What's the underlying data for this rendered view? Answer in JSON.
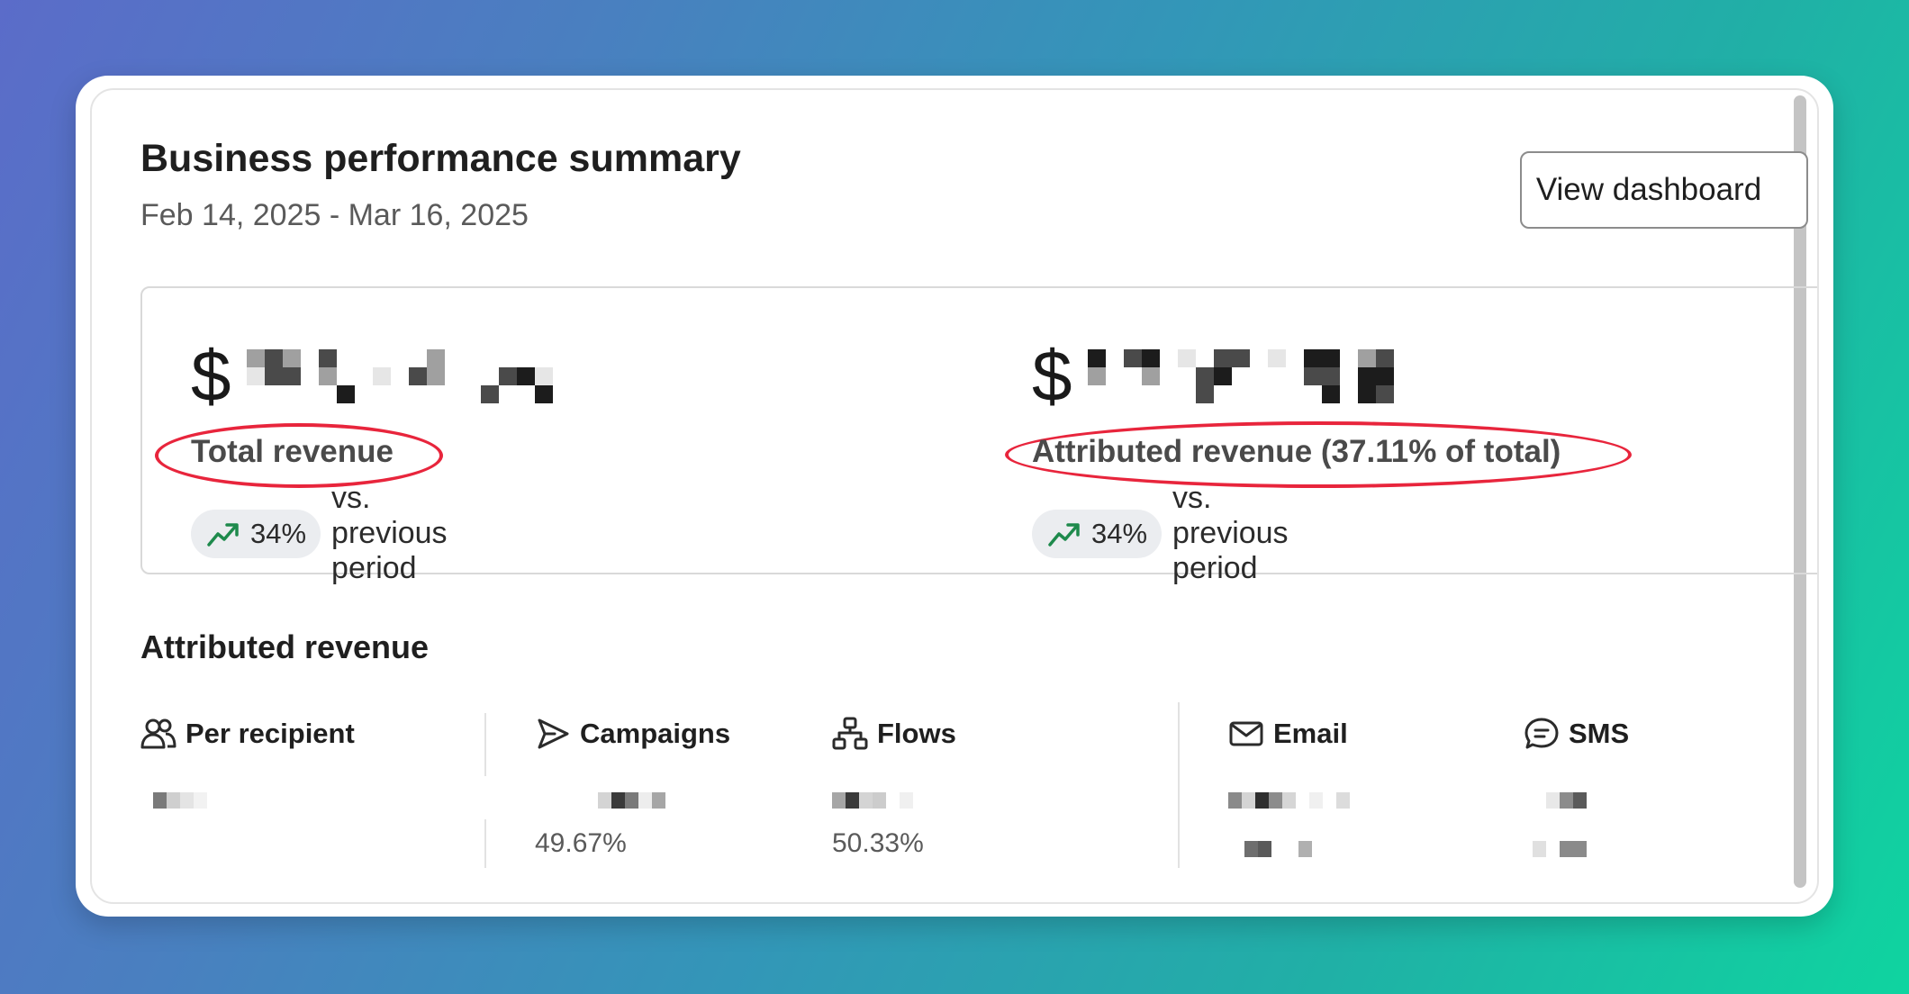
{
  "card": {
    "title": "Business performance summary",
    "date_range": "Feb 14, 2025 - Mar 16, 2025",
    "view_dashboard_label": "View dashboard"
  },
  "metrics": {
    "total": {
      "currency": "$",
      "label": "Total revenue",
      "delta": "34%",
      "delta_suffix": "vs. previous period"
    },
    "attributed": {
      "currency": "$",
      "label": "Attributed revenue (37.11% of total)",
      "delta": "34%",
      "delta_suffix": "vs. previous period"
    }
  },
  "attributed_section": {
    "title": "Attributed revenue",
    "per_recipient_label": "Per recipient",
    "campaigns_label": "Campaigns",
    "campaigns_share": "49.67%",
    "flows_label": "Flows",
    "flows_share": "50.33%",
    "email_label": "Email",
    "sms_label": "SMS"
  },
  "colors": {
    "highlight_ellipse": "#e8253c",
    "trend_up": "#1e8a4c",
    "background_gradient_start": "#5b6cc9",
    "background_gradient_end": "#0fd4a0"
  },
  "icons": {
    "trend": "trend-up-icon",
    "per_recipient": "users-icon",
    "campaigns": "send-icon",
    "flows": "flow-icon",
    "email": "mail-icon",
    "sms": "chat-icon"
  }
}
